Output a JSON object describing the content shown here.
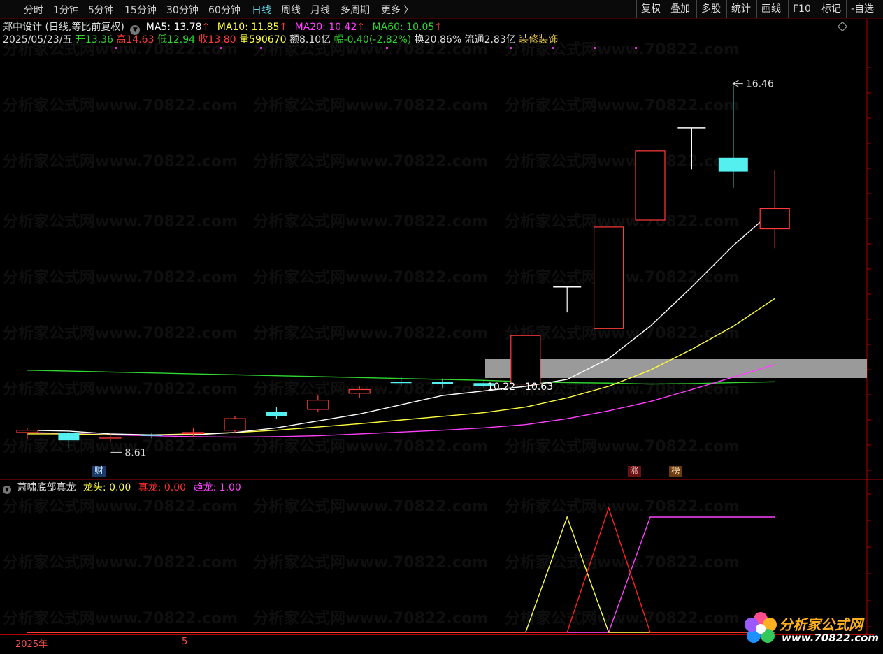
{
  "toolbar": {
    "tabs": [
      {
        "label": "分时",
        "active": false
      },
      {
        "label": "1分钟",
        "active": false
      },
      {
        "label": "5分钟",
        "active": false
      },
      {
        "label": "15分钟",
        "active": false
      },
      {
        "label": "30分钟",
        "active": false
      },
      {
        "label": "60分钟",
        "active": false
      },
      {
        "label": "日线",
        "active": true
      },
      {
        "label": "周线",
        "active": false
      },
      {
        "label": "月线",
        "active": false
      },
      {
        "label": "多周期",
        "active": false
      },
      {
        "label": "更多 〉",
        "active": false
      }
    ],
    "right_tabs": [
      "复权",
      "叠加",
      "多股",
      "统计",
      "画线",
      "F10",
      "标记",
      "-自选"
    ]
  },
  "stock": {
    "title": "郑中设计 (日线,等比前复权)",
    "ma5": "MA5: 13.78",
    "ma10": "MA10: 11.85",
    "ma20": "MA20: 10.42",
    "ma60": "MA60: 10.05",
    "arrow": "↑",
    "date": "2025/05/23/五",
    "open": "开13.36",
    "high": "高14.63",
    "low": "低12.94",
    "close": "收13.80",
    "volume": "量590670",
    "amount": "额8.10亿",
    "change": "幅-0.40(-2.82%)",
    "turnover": "换20.86%",
    "float_cap": "流通2.83亿",
    "sector": "装修装饰"
  },
  "annotations": {
    "high_label": "16.46",
    "low_label": "8.61",
    "zone_label": "10.22 - 10.63",
    "badge_cai": "财",
    "badge_zhang": "涨",
    "badge_bang": "榜"
  },
  "indicator": {
    "name": "萧啸底部真龙",
    "longtou": "龙头: 0.00",
    "zhenlong": "真龙: 0.00",
    "qulong": "趋龙: 1.00"
  },
  "axis": {
    "year": "2025年",
    "month": "5"
  },
  "watermark": {
    "text": "分析家公式网www.70822.com",
    "logo_title": "分析家公式网",
    "logo_url": "www.70822.com"
  },
  "colors": {
    "up": "#ff3b3b",
    "down": "#54f0f0",
    "ma5": "#ffffff",
    "ma10": "#ffff40",
    "ma20": "#ff40ff",
    "ma60": "#2ed62e",
    "longtou": "#ffff40",
    "zhenlong": "#ff2020",
    "qulong": "#ff40ff"
  },
  "chart_data": {
    "type": "candlestick",
    "price_scale": "等比前复权",
    "candles": [
      {
        "o": 8.95,
        "h": 9.05,
        "l": 8.8,
        "c": 9.0
      },
      {
        "o": 8.95,
        "h": 9.0,
        "l": 8.61,
        "c": 8.78
      },
      {
        "o": 8.85,
        "h": 8.95,
        "l": 8.75,
        "c": 8.85
      },
      {
        "o": 8.9,
        "h": 8.95,
        "l": 8.82,
        "c": 8.88
      },
      {
        "o": 8.95,
        "h": 9.05,
        "l": 8.85,
        "c": 8.95
      },
      {
        "o": 9.0,
        "h": 9.3,
        "l": 8.95,
        "c": 9.25
      },
      {
        "o": 9.4,
        "h": 9.5,
        "l": 9.25,
        "c": 9.3
      },
      {
        "o": 9.45,
        "h": 9.75,
        "l": 9.4,
        "c": 9.65
      },
      {
        "o": 9.8,
        "h": 9.95,
        "l": 9.7,
        "c": 9.88
      },
      {
        "o": 10.05,
        "h": 10.15,
        "l": 9.95,
        "c": 10.02
      },
      {
        "o": 10.05,
        "h": 10.12,
        "l": 9.9,
        "c": 10.0
      },
      {
        "o": 10.02,
        "h": 10.08,
        "l": 9.9,
        "c": 9.95
      },
      {
        "o": 10.0,
        "h": 11.05,
        "l": 10.0,
        "c": 11.05
      },
      {
        "o": 12.1,
        "h": 12.1,
        "l": 11.55,
        "c": 12.1
      },
      {
        "o": 11.2,
        "h": 13.4,
        "l": 11.2,
        "c": 13.4
      },
      {
        "o": 13.55,
        "h": 15.05,
        "l": 13.55,
        "c": 15.05
      },
      {
        "o": 15.55,
        "h": 15.55,
        "l": 14.65,
        "c": 15.55
      },
      {
        "o": 14.9,
        "h": 16.46,
        "l": 14.25,
        "c": 14.6
      },
      {
        "o": 13.36,
        "h": 14.63,
        "l": 12.94,
        "c": 13.8
      }
    ],
    "ma5": [
      9.0,
      8.98,
      8.92,
      8.9,
      8.9,
      8.95,
      9.05,
      9.2,
      9.35,
      9.55,
      9.75,
      9.85,
      9.95,
      10.1,
      10.55,
      11.25,
      12.1,
      13.0,
      13.78
    ],
    "ma10": [
      8.92,
      8.92,
      8.9,
      8.9,
      8.92,
      8.95,
      9.0,
      9.07,
      9.14,
      9.22,
      9.3,
      9.38,
      9.5,
      9.7,
      9.95,
      10.3,
      10.75,
      11.25,
      11.85
    ],
    "ma20": [
      8.95,
      8.93,
      8.9,
      8.88,
      8.86,
      8.85,
      8.86,
      8.88,
      8.92,
      8.96,
      9.0,
      9.05,
      9.12,
      9.25,
      9.42,
      9.62,
      9.88,
      10.15,
      10.42
    ],
    "ma60": [
      10.3,
      10.28,
      10.26,
      10.24,
      10.22,
      10.2,
      10.18,
      10.16,
      10.14,
      10.12,
      10.1,
      10.08,
      10.05,
      10.03,
      10.02,
      10.0,
      10.01,
      10.03,
      10.05
    ],
    "zone": [
      10.22,
      10.63
    ],
    "yrange": [
      8.45,
      17.0
    ],
    "indicator": {
      "longtou": [
        0,
        0,
        0,
        0,
        0,
        0,
        0,
        0,
        0,
        0,
        0,
        0,
        0,
        1.0,
        0,
        0,
        0,
        0,
        0
      ],
      "zhenlong": [
        0,
        0,
        0,
        0,
        0,
        0,
        0,
        0,
        0,
        0,
        0,
        0,
        0,
        0,
        0,
        0,
        0,
        0,
        0
      ],
      "zhenlong_spike": [
        0,
        0,
        0,
        0,
        0,
        0,
        0,
        0,
        0,
        0,
        0,
        0,
        0,
        0,
        1.08,
        0,
        0,
        0,
        0
      ],
      "qulong": [
        0,
        0,
        0,
        0,
        0,
        0,
        0,
        0,
        0,
        0,
        0,
        0,
        0,
        0,
        0,
        1.0,
        1.0,
        1.0,
        1.0
      ],
      "yrange": [
        0,
        1.2
      ]
    }
  }
}
